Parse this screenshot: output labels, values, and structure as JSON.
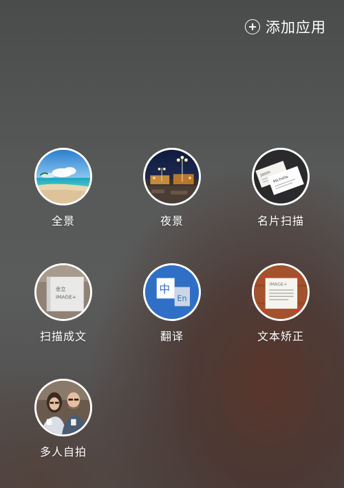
{
  "header": {
    "add_app_label": "添加应用",
    "add_icon": "plus-circle-icon"
  },
  "apps": [
    {
      "label": "全景",
      "icon": "panorama-icon"
    },
    {
      "label": "夜景",
      "icon": "night-scene-icon"
    },
    {
      "label": "名片扫描",
      "icon": "business-card-scan-icon"
    },
    {
      "label": "扫描成文",
      "icon": "scan-to-text-icon"
    },
    {
      "label": "翻译",
      "icon": "translate-icon"
    },
    {
      "label": "文本矫正",
      "icon": "text-correction-icon"
    },
    {
      "label": "多人自拍",
      "icon": "group-selfie-icon"
    }
  ],
  "icon_texts": {
    "card_name_1": "Jason",
    "card_name_2": "Michelle",
    "scan_brand": "金立",
    "scan_product": "IMAGE+",
    "translate_zh": "中",
    "translate_en": "En",
    "correction_product": "IMAGE+"
  },
  "colors": {
    "translate_bg": "#2f6fc6",
    "correction_bg": "#a2522c",
    "ring": "#ffffff"
  }
}
